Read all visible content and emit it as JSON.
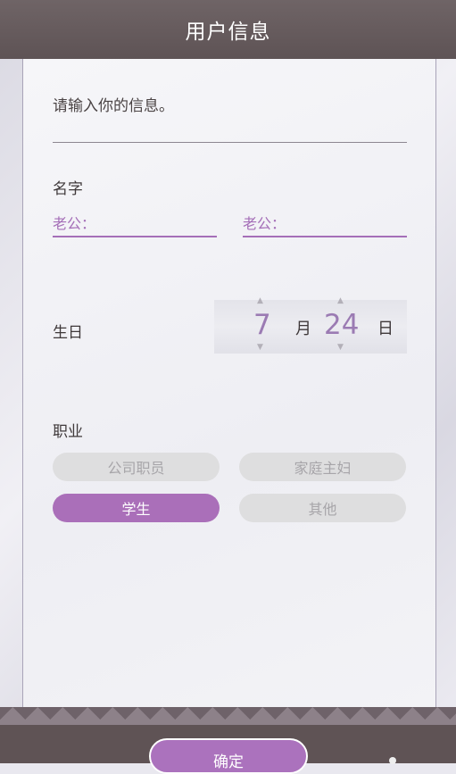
{
  "header": {
    "title": "用户信息"
  },
  "form": {
    "prompt": "请输入你的信息。",
    "name": {
      "label": "名字",
      "field1_placeholder": "老公：",
      "field2_placeholder": "老公："
    },
    "birthday": {
      "label": "生日",
      "month_value": "7",
      "month_unit": "月",
      "day_value": "24",
      "day_unit": "日"
    },
    "occupation": {
      "label": "职业",
      "options": [
        "公司职员",
        "家庭主妇",
        "学生",
        "其他"
      ],
      "selected": "学生"
    }
  },
  "footer": {
    "confirm_label": "确定"
  },
  "colors": {
    "accent": "#aa6fb9",
    "header": "#5e5355"
  }
}
